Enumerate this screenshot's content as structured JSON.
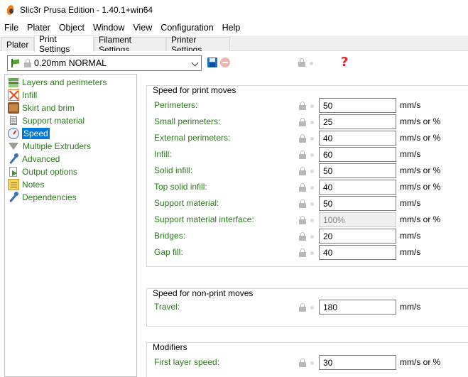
{
  "window": {
    "title": "Slic3r Prusa Edition - 1.40.1+win64"
  },
  "menu": [
    "File",
    "Plater",
    "Object",
    "Window",
    "View",
    "Configuration",
    "Help"
  ],
  "tabs": [
    "Plater",
    "Print Settings",
    "Filament Settings",
    "Printer Settings"
  ],
  "active_tab": "Print Settings",
  "toolbar": {
    "preset": "0.20mm NORMAL",
    "help_symbol": "?"
  },
  "tree": [
    {
      "label": "Layers and perimeters",
      "icon": "layers-icon"
    },
    {
      "label": "Infill",
      "icon": "infill-icon"
    },
    {
      "label": "Skirt and brim",
      "icon": "skirt-icon"
    },
    {
      "label": "Support material",
      "icon": "support-icon"
    },
    {
      "label": "Speed",
      "icon": "speedometer-icon",
      "selected": true
    },
    {
      "label": "Multiple Extruders",
      "icon": "funnel-icon"
    },
    {
      "label": "Advanced",
      "icon": "wrench-icon"
    },
    {
      "label": "Output options",
      "icon": "output-icon"
    },
    {
      "label": "Notes",
      "icon": "notes-icon"
    },
    {
      "label": "Dependencies",
      "icon": "wrench-icon"
    }
  ],
  "sections": [
    {
      "title": "Speed for print moves",
      "rows": [
        {
          "label": "Perimeters:",
          "value": "50",
          "unit": "mm/s"
        },
        {
          "label": "Small perimeters:",
          "value": "25",
          "unit": "mm/s or %"
        },
        {
          "label": "External perimeters:",
          "value": "40",
          "unit": "mm/s or %"
        },
        {
          "label": "Infill:",
          "value": "60",
          "unit": "mm/s"
        },
        {
          "label": "Solid infill:",
          "value": "50",
          "unit": "mm/s or %"
        },
        {
          "label": "Top solid infill:",
          "value": "40",
          "unit": "mm/s or %"
        },
        {
          "label": "Support material:",
          "value": "50",
          "unit": "mm/s"
        },
        {
          "label": "Support material interface:",
          "value": "100%",
          "unit": "mm/s or %",
          "disabled": true
        },
        {
          "label": "Bridges:",
          "value": "20",
          "unit": "mm/s"
        },
        {
          "label": "Gap fill:",
          "value": "40",
          "unit": "mm/s"
        }
      ]
    },
    {
      "title": "Speed for non-print moves",
      "rows": [
        {
          "label": "Travel:",
          "value": "180",
          "unit": "mm/s"
        }
      ]
    },
    {
      "title": "Modifiers",
      "rows": [
        {
          "label": "First layer speed:",
          "value": "30",
          "unit": "mm/s or %"
        }
      ]
    }
  ]
}
